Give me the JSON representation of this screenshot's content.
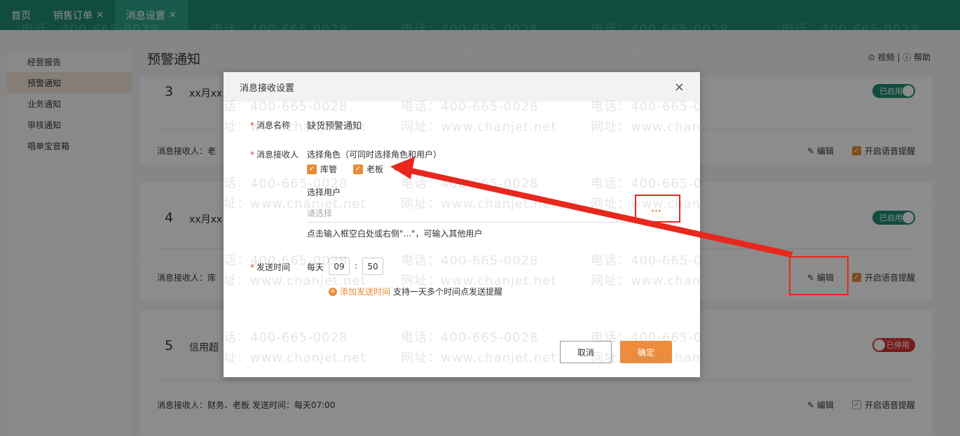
{
  "tabs": [
    {
      "label": "首页",
      "closable": false,
      "active": false
    },
    {
      "label": "销售订单",
      "closable": true,
      "active": false
    },
    {
      "label": "消息设置",
      "closable": true,
      "active": true
    }
  ],
  "tab_close_glyph": "×",
  "sidebar": {
    "items": [
      {
        "label": "经营报告",
        "active": false
      },
      {
        "label": "预警通知",
        "active": true
      },
      {
        "label": "业务通知",
        "active": false
      },
      {
        "label": "审核通知",
        "active": false
      },
      {
        "label": "唱单宝音箱",
        "active": false
      }
    ]
  },
  "page": {
    "title": "预警通知",
    "help_text": "⊙ 视频 | ⓘ 帮助"
  },
  "cards": [
    {
      "num": "3",
      "title": "xx月xx",
      "receivers": "消息接收人：老",
      "edit_label": "编辑",
      "voice_label": "开启语音提醒",
      "voice_checked": true,
      "status": "已启用",
      "enabled": true
    },
    {
      "num": "4",
      "title": "xx月xx",
      "receivers": "消息接收人：库",
      "edit_label": "编辑",
      "voice_label": "开启语音提醒",
      "voice_checked": true,
      "status": "已启用",
      "enabled": true
    },
    {
      "num": "5",
      "title": "信用超",
      "receivers": "消息接收人：财务、老板      发送时间：每天07:00",
      "edit_label": "编辑",
      "voice_label": "开启语音提醒",
      "voice_checked": false,
      "status": "已停用",
      "enabled": false
    }
  ],
  "modal": {
    "title": "消息接收设置",
    "close_glyph": "×",
    "name_label": "消息名称",
    "name_value": "缺货预警通知",
    "receiver_label": "消息接收人",
    "role_hint": "选择角色（可同时选择角色和用户）",
    "roles": [
      {
        "label": "库管",
        "checked": true
      },
      {
        "label": "老板",
        "checked": true
      }
    ],
    "user_label": "选择用户",
    "user_placeholder": "请选择",
    "user_dots": "···",
    "user_hint": "点击输入框空白处或右侧\"...\"，可输入其他用户",
    "time_label": "发送时间",
    "time_prefix": "每天",
    "hour": "09",
    "minute": "50",
    "time_sep": ":",
    "add_time_label": "添加发送时间",
    "add_time_hint": "支持一天多个时间点发送提醒",
    "cancel_label": "取消",
    "ok_label": "确定"
  },
  "watermark": {
    "phone": "电话：400-665-0028",
    "site": "网址：www.chanjet.net"
  },
  "colors": {
    "topbar": "#1f8a73",
    "accent": "#ee8c3c",
    "annotation": "#e8271d"
  },
  "required_mark": "*",
  "icons": {
    "edit": "edit-icon",
    "check": "checkbox-checked-icon",
    "plus": "plus-circle-icon",
    "close": "close-icon"
  }
}
